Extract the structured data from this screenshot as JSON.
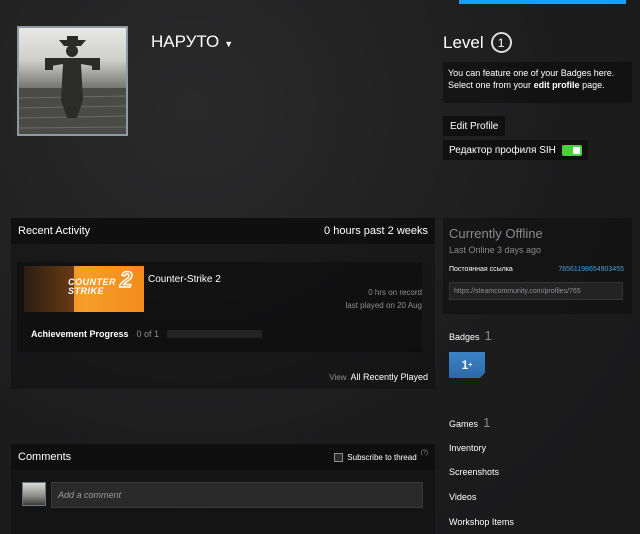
{
  "profile": {
    "persona_name": "НАРУТО",
    "level_label": "Level",
    "level_value": "1",
    "badge_hint_text": "You can feature one of your Badges here. Select one from your",
    "badge_hint_link": "edit profile",
    "badge_hint_suffix": "page.",
    "edit_profile_label": "Edit Profile",
    "sih_editor_label": "Редактор профиля SIH",
    "sih_toggle_on": true
  },
  "recent_activity": {
    "title": "Recent Activity",
    "hours_summary": "0 hours past 2 weeks",
    "game": {
      "name": "Counter-Strike 2",
      "capsule_text": "COUNTER STRIKE",
      "capsule_number": "2",
      "hrs_on_record": "0 hrs on record",
      "last_played": "last played on 20 Aug",
      "achievement_label": "Achievement Progress",
      "achievement_count": "0 of 1",
      "achievement_fraction": 0
    },
    "view_label": "View",
    "view_all_label": "All Recently Played"
  },
  "comments": {
    "title": "Comments",
    "subscribe_label": "Subscribe to thread",
    "help_mark": "(?)",
    "placeholder": "Add a comment"
  },
  "status": {
    "title": "Currently Offline",
    "last_online": "Last Online 3 days ago",
    "permalink_label": "Постоянная ссылка",
    "steam_id": "76561198654903455",
    "profile_url": "https://steamcommunity.com/profiles/765"
  },
  "sidebar": {
    "badges_label": "Badges",
    "badges_count": "1",
    "badge_icon_text": "1",
    "badge_icon_sup": "+",
    "games_label": "Games",
    "games_count": "1",
    "inventory_label": "Inventory",
    "screenshots_label": "Screenshots",
    "videos_label": "Videos",
    "workshop_label": "Workshop Items"
  },
  "colors": {
    "accent_blue": "#1a9fff",
    "toggle_green": "#4ccf3f",
    "link_blue": "#4c9fd6",
    "capsule_orange": "#f59d2a"
  }
}
